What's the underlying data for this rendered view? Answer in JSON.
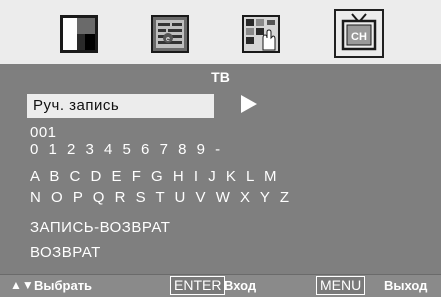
{
  "menu_icons": [
    {
      "name": "picture-icon",
      "selected": false
    },
    {
      "name": "sound-icon",
      "selected": false
    },
    {
      "name": "feature-icon",
      "selected": false
    },
    {
      "name": "channel-icon",
      "selected": true,
      "label": "CH"
    }
  ],
  "title": "ТВ",
  "items": {
    "manual_record": "Руч. запись",
    "channel_number": "001",
    "digits": "0 1 2 3 4 5 6 7 8 9 -",
    "letters_row1": "A B C D E F G H I J K L M",
    "letters_row2": "N O P Q R S T U V W X Y Z",
    "record_return": "ЗАПИСЬ-ВОЗВРАТ",
    "return": "ВОЗВРАТ"
  },
  "footer": {
    "select_arrows": "▲▼",
    "select_label": "Выбрать",
    "enter_key": "ENTER",
    "enter_label": "Вход",
    "menu_key": "MENU",
    "menu_label": "Выход"
  },
  "colors": {
    "panel_bg": "#7f7f7f",
    "topbar_bg": "#ececec",
    "highlight_bg": "#ececec",
    "text": "#ffffff"
  }
}
